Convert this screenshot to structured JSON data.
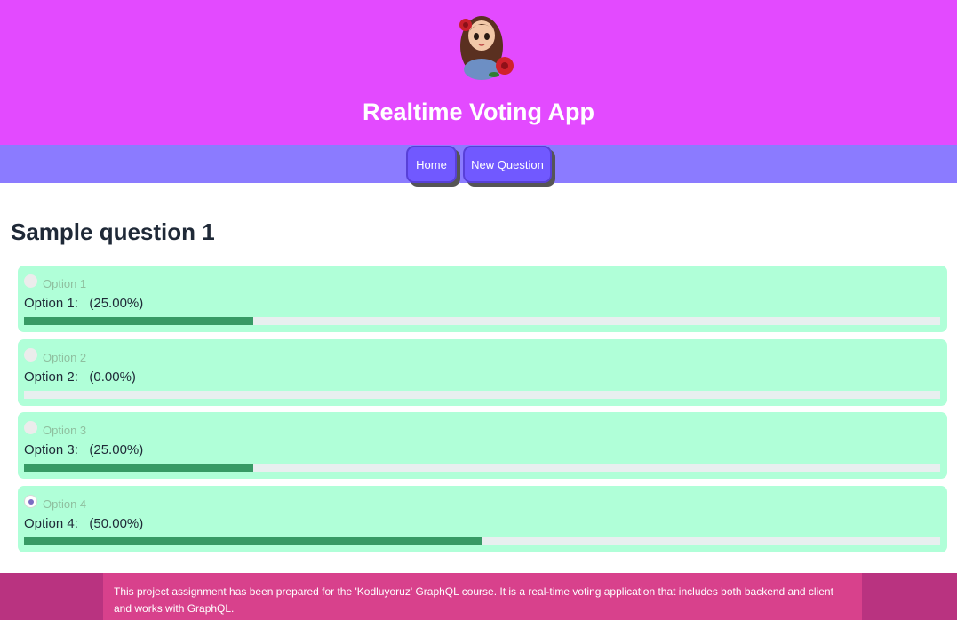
{
  "header": {
    "title": "Realtime Voting App",
    "avatar_icon": "girl-with-roses-avatar"
  },
  "nav": {
    "items": [
      {
        "label": "Home"
      },
      {
        "label": "New Question"
      }
    ]
  },
  "question": {
    "title": "Sample question 1",
    "options": [
      {
        "label": "Option 1",
        "result": "Option 1:   (25.00%)",
        "percent": 25,
        "selected": false
      },
      {
        "label": "Option 2",
        "result": "Option 2:   (0.00%)",
        "percent": 0,
        "selected": false
      },
      {
        "label": "Option 3",
        "result": "Option 3:   (25.00%)",
        "percent": 25,
        "selected": false
      },
      {
        "label": "Option 4",
        "result": "Option 4:   (50.00%)",
        "percent": 50,
        "selected": true
      }
    ]
  },
  "footer": {
    "text": "This project assignment has been prepared for the 'Kodluyoruz' GraphQL course. It is a real-time voting application that includes both backend and client and works with GraphQL."
  },
  "colors": {
    "header_bg": "#e34aff",
    "nav_bg": "#8b7bff",
    "card_bg": "#b0ffd8",
    "progress_fill": "#379a65",
    "footer_bg": "#b93380"
  }
}
